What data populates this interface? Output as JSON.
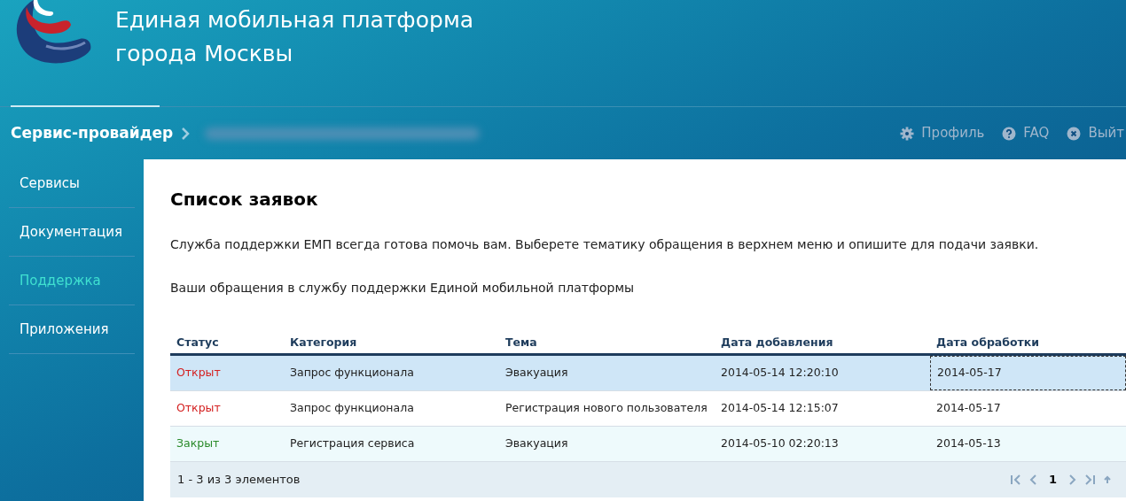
{
  "header": {
    "title_lines": [
      "Единая мобильная платформа",
      "города Москвы"
    ]
  },
  "nav": {
    "breadcrumb": "Сервис-провайдер",
    "links": [
      {
        "kind": "gear",
        "label": "Профиль"
      },
      {
        "kind": "help",
        "label": "FAQ"
      },
      {
        "kind": "close",
        "label": "Выйт"
      }
    ]
  },
  "sidebar": {
    "items": [
      {
        "label": "Сервисы",
        "selected": false
      },
      {
        "label": "Документация",
        "selected": false
      },
      {
        "label": "Поддержка",
        "selected": true
      },
      {
        "label": "Приложения",
        "selected": false
      }
    ]
  },
  "page": {
    "title": "Список заявок",
    "intro": "Служба поддержки ЕМП всегда готова помочь вам. Выберете тематику обращения в верхнем меню и опишите для подачи заявки.",
    "subtitle": "Ваши обращения в службу поддержки Единой мобильной платформы"
  },
  "table": {
    "columns": [
      "Статус",
      "Категория",
      "Тема",
      "Дата добавления",
      "Дата обработки"
    ],
    "rows": [
      {
        "status": "Открыт",
        "color": "#d42020",
        "category": "Запрос функционала",
        "topic": "Эвакуация",
        "added": "2014-05-14 12:20:10",
        "processed": "2014-05-17",
        "selected": true,
        "focused": true
      },
      {
        "status": "Открыт",
        "color": "#d42020",
        "category": "Запрос функционала",
        "topic": "Регистрация нового пользователя",
        "added": "2014-05-14 12:15:07",
        "processed": "2014-05-17",
        "selected": false,
        "focused": false
      },
      {
        "status": "Закрыт",
        "color": "#2a8a2a",
        "category": "Регистрация сервиса",
        "topic": "Эвакуация",
        "added": "2014-05-10 02:20:13",
        "processed": "2014-05-13",
        "selected": false,
        "focused": false
      }
    ],
    "footer": {
      "summary": "1 - 3 из 3 элементов",
      "page": "1"
    }
  }
}
